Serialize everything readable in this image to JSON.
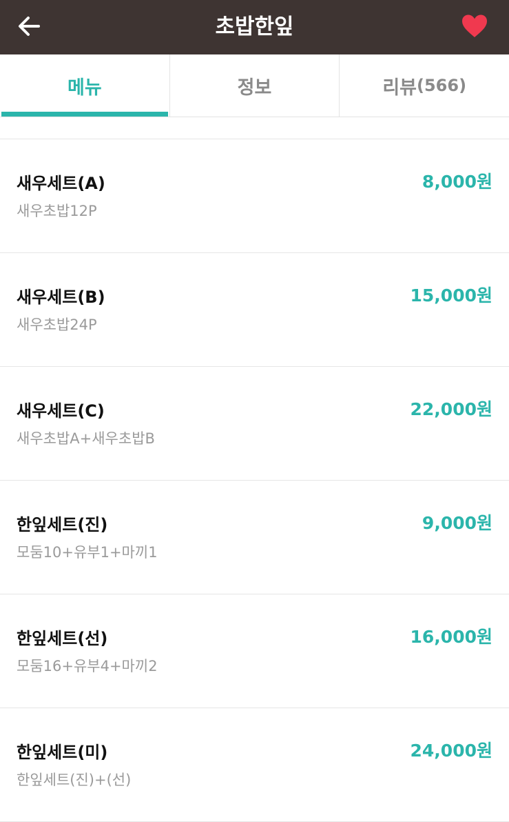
{
  "header": {
    "title": "초밥한잎",
    "back_icon": "arrow-left-icon",
    "favorite_icon": "heart-icon",
    "favorited": true
  },
  "colors": {
    "header_bg": "#3e3432",
    "accent": "#2bb5ab",
    "heart": "#f0394f"
  },
  "tabs": [
    {
      "label": "메뉴",
      "active": true
    },
    {
      "label": "정보",
      "active": false
    },
    {
      "label": "리뷰",
      "count": "566",
      "active": false
    }
  ],
  "menu": {
    "items": [
      {
        "name": "새우세트(A)",
        "desc": "새우초밥12P",
        "price": "8,000원"
      },
      {
        "name": "새우세트(B)",
        "desc": "새우초밥24P",
        "price": "15,000원"
      },
      {
        "name": "새우세트(C)",
        "desc": "새우초밥A+새우초밥B",
        "price": "22,000원"
      },
      {
        "name": "한잎세트(진)",
        "desc": "모둠10+유부1+마끼1",
        "price": "9,000원"
      },
      {
        "name": "한잎세트(선)",
        "desc": "모둠16+유부4+마끼2",
        "price": "16,000원"
      },
      {
        "name": "한잎세트(미)",
        "desc": "한잎세트(진)+(선)",
        "price": "24,000원"
      }
    ]
  }
}
